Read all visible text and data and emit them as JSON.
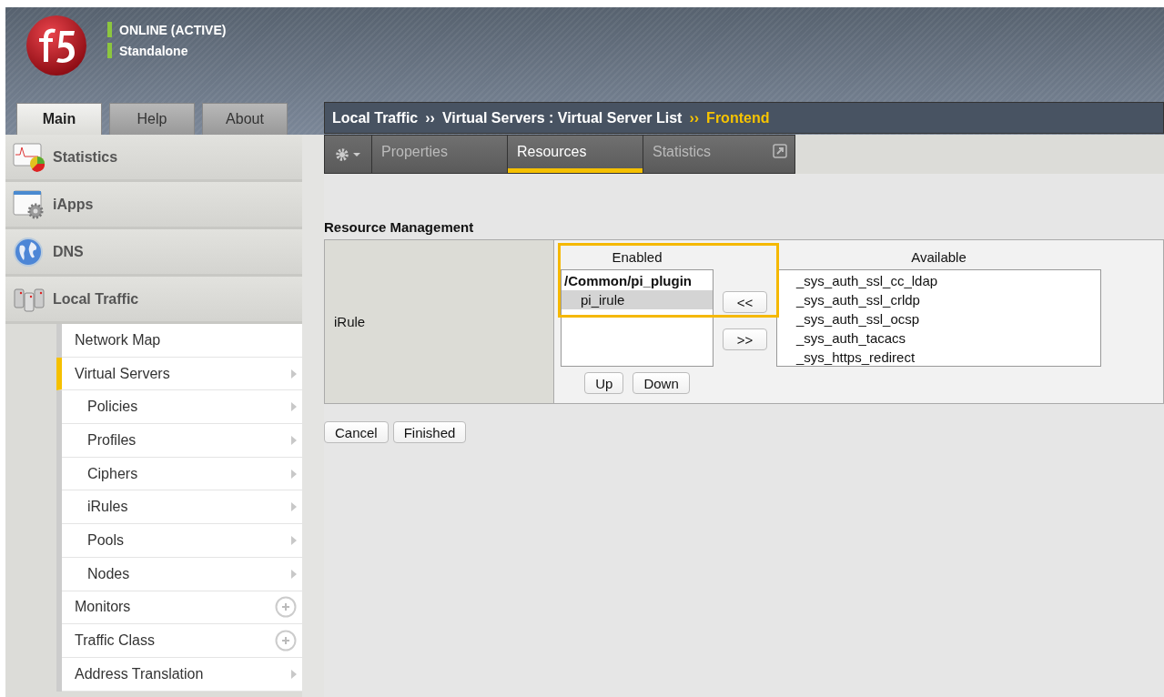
{
  "header": {
    "status": [
      {
        "text": "ONLINE (ACTIVE)"
      },
      {
        "text": "Standalone"
      }
    ]
  },
  "top_tabs": [
    {
      "label": "Main",
      "selected": true
    },
    {
      "label": "Help",
      "selected": false
    },
    {
      "label": "About",
      "selected": false
    }
  ],
  "sidebar": {
    "sections": [
      {
        "label": "Statistics",
        "kind": "chart"
      },
      {
        "label": "iApps",
        "kind": "app"
      },
      {
        "label": "DNS",
        "kind": "globe"
      },
      {
        "label": "Local Traffic",
        "kind": "servers",
        "children": [
          {
            "label": "Network Map",
            "kind": "plain",
            "selected": false
          },
          {
            "label": "Virtual Servers",
            "kind": "arrow",
            "selected": true,
            "children": [
              {
                "label": "Policies",
                "kind": "arrow",
                "selected": false
              },
              {
                "label": "Profiles",
                "kind": "arrow",
                "selected": false
              },
              {
                "label": "Ciphers",
                "kind": "arrow",
                "selected": false
              },
              {
                "label": "iRules",
                "kind": "arrow",
                "selected": false
              },
              {
                "label": "Pools",
                "kind": "arrow",
                "selected": false
              },
              {
                "label": "Nodes",
                "kind": "arrow",
                "selected": false
              }
            ]
          },
          {
            "label": "Monitors",
            "kind": "add",
            "selected": false
          },
          {
            "label": "Traffic Class",
            "kind": "add",
            "selected": false
          },
          {
            "label": "Address Translation",
            "kind": "arrow",
            "selected": false
          }
        ]
      }
    ]
  },
  "breadcrumb": [
    {
      "text": "Local Traffic",
      "current": false
    },
    {
      "separator": "››",
      "text": "Virtual Servers : Virtual Server List",
      "current": false
    },
    {
      "separator": "››",
      "text": "Frontend",
      "current": true
    }
  ],
  "tabs": [
    {
      "label": "Properties",
      "selected": false
    },
    {
      "label": "Resources",
      "selected": true
    },
    {
      "label": "Statistics",
      "selected": false,
      "external": true
    }
  ],
  "section_title": "Resource Management",
  "irule": {
    "label": "iRule",
    "enabled_title": "Enabled",
    "enabled_highlighted": true,
    "enabled": [
      {
        "text": "/Common/pi_plugin",
        "kind": "group",
        "selected": false
      },
      {
        "text": "pi_irule",
        "kind": "item",
        "selected": true
      }
    ],
    "move_left": "<<",
    "move_right": ">>",
    "up": "Up",
    "down": "Down",
    "available_title": "Available",
    "available": [
      "_sys_auth_ssl_cc_ldap",
      "_sys_auth_ssl_crldp",
      "_sys_auth_ssl_ocsp",
      "_sys_auth_tacacs",
      "_sys_https_redirect"
    ]
  },
  "buttons": [
    "Cancel",
    "Finished"
  ]
}
